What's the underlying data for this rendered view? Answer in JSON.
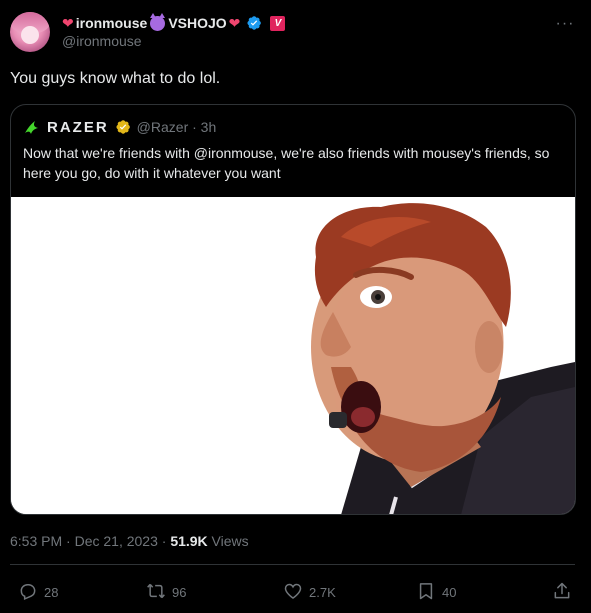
{
  "author": {
    "display_name_text": "ironmouse",
    "display_name_suffix": "VSHOJO",
    "handle": "@ironmouse",
    "affiliate_badge_letter": "V"
  },
  "tweet": {
    "text": "You guys know what to do lol."
  },
  "quoted_tweet": {
    "author_name": "RAZER",
    "handle_time": "@Razer · 3h",
    "text": "Now that we're friends with @ironmouse, we're also friends with mousey's friends, so here you go, do with it whatever you want"
  },
  "meta": {
    "timestamp": "6:53 PM · Dec 21, 2023 · ",
    "views_count": "51.9K",
    "views_label": " Views"
  },
  "actions": {
    "replies": "28",
    "reposts": "96",
    "likes": "2.7K",
    "bookmarks": "40"
  },
  "colors": {
    "background": "#000000",
    "text_primary": "#e7e9ea",
    "text_secondary": "#71767b",
    "verified_blue": "#1d9bf0",
    "verified_gold": "#e2b719",
    "border": "#2f3336"
  }
}
